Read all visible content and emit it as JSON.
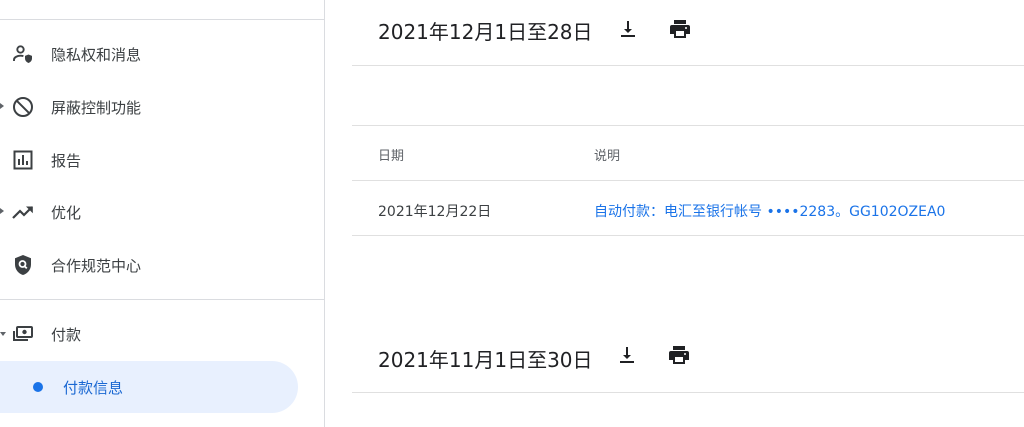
{
  "sidebar": {
    "items": [
      {
        "label": "隐私权和消息",
        "icon": "account-shield-icon",
        "has_caret": false
      },
      {
        "label": "屏蔽控制功能",
        "icon": "block-icon",
        "has_caret": true
      },
      {
        "label": "报告",
        "icon": "bar-chart-icon",
        "has_caret": false
      },
      {
        "label": "优化",
        "icon": "trending-up-icon",
        "has_caret": true
      },
      {
        "label": "合作规范中心",
        "icon": "policy-shield-icon",
        "has_caret": false
      },
      {
        "label": "付款",
        "icon": "payments-icon",
        "has_caret": true,
        "expanded": true
      }
    ],
    "sub_items": [
      {
        "label": "付款信息",
        "selected": true
      }
    ]
  },
  "statements": [
    {
      "title": "2021年12月1日至28日",
      "download_icon": "download-icon",
      "print_icon": "print-icon",
      "table": {
        "columns": [
          "日期",
          "说明"
        ],
        "rows": [
          {
            "date": "2021年12月22日",
            "description": "自动付款：电汇至银行帐号 ••••2283。GG102OZEA0"
          }
        ]
      }
    },
    {
      "title": "2021年11月1日至30日",
      "download_icon": "download-icon",
      "print_icon": "print-icon"
    }
  ],
  "colors": {
    "accent": "#1a73e8",
    "selected_bg": "#e8f0fe",
    "divider": "#dadce0",
    "text": "#202124",
    "muted": "#5f6368"
  }
}
